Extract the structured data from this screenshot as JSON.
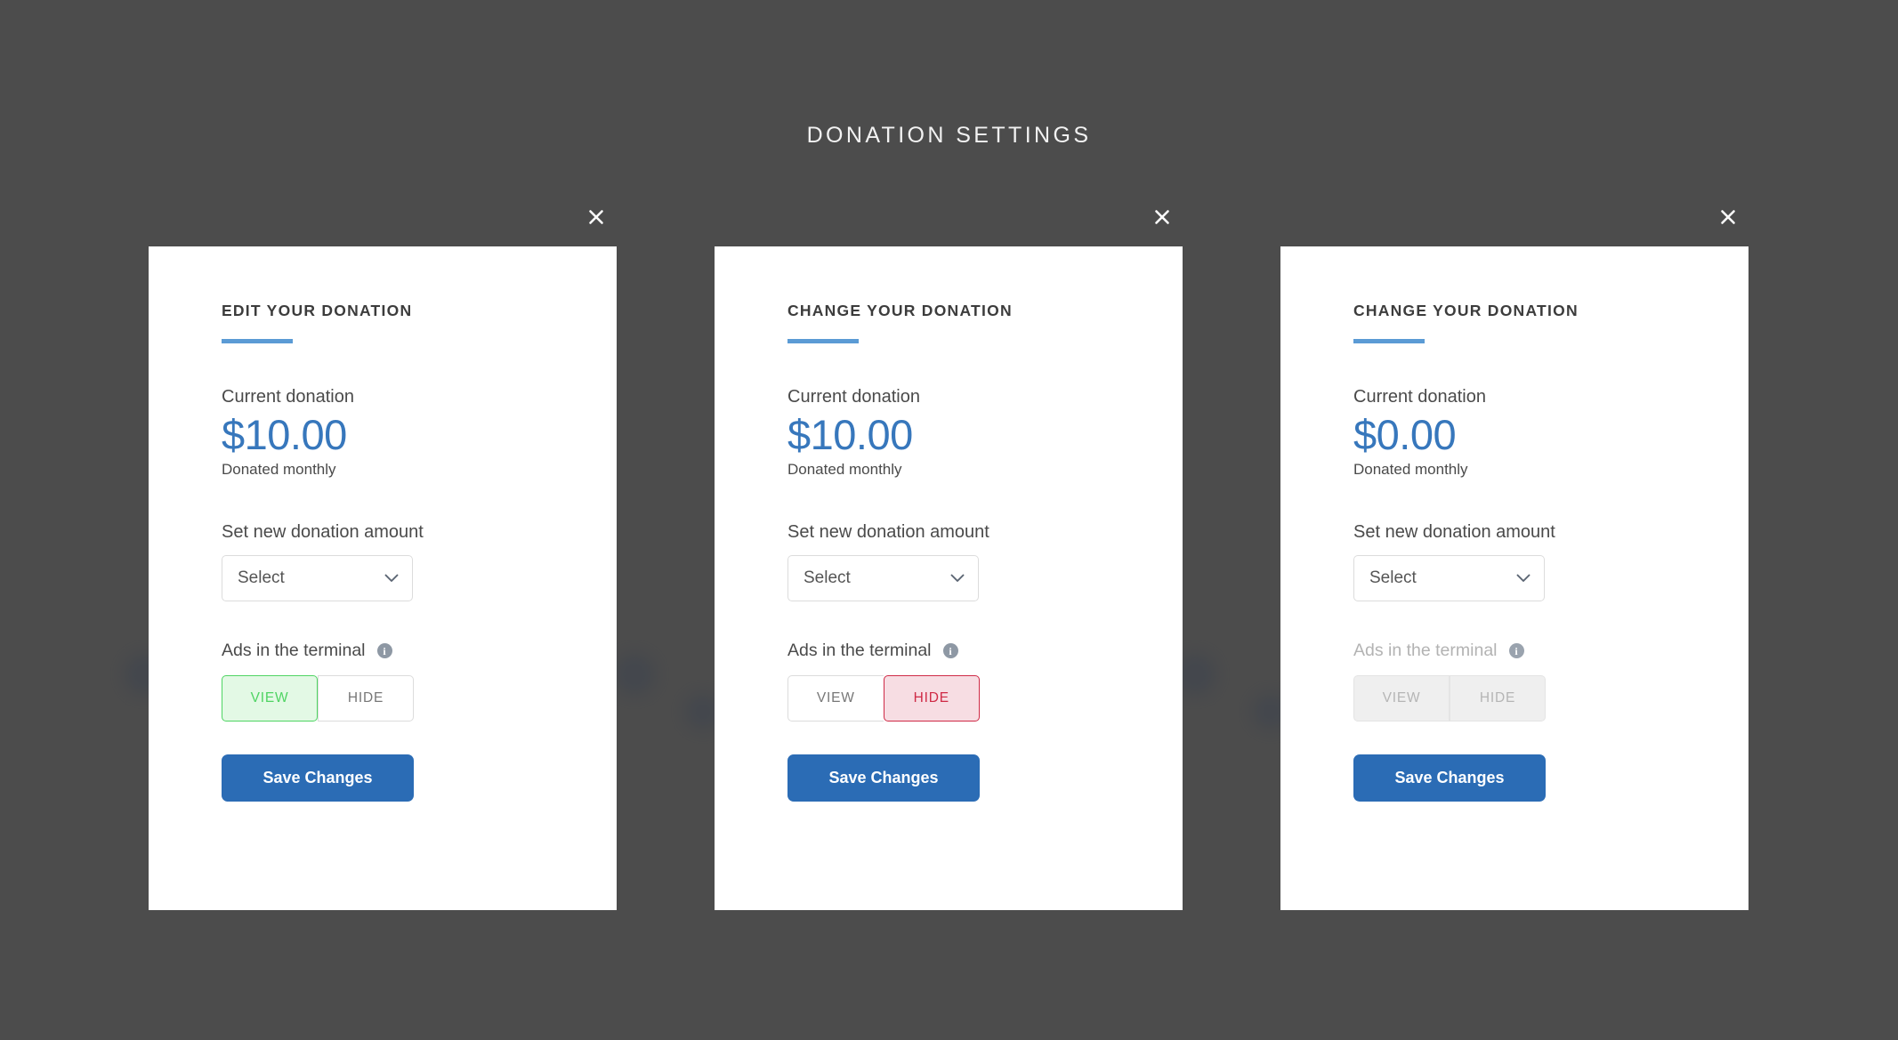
{
  "page": {
    "title": "DONATION SETTINGS",
    "background_color": "#4d4d4d",
    "accent_color": "#5b9bd5",
    "amount_color": "#3777bc",
    "save_button_color": "#2b6cb5",
    "view_active_color": "#4fd463",
    "hide_active_color": "#cf2a46"
  },
  "close_icon": "close-icon",
  "cards": [
    {
      "title": "EDIT YOUR DONATION",
      "current_label": "Current donation",
      "amount": "$10.00",
      "frequency": "Donated monthly",
      "set_amount_label": "Set new donation amount",
      "select": {
        "value": "Select",
        "placeholder": "Select",
        "chevron": "chevron-down-icon"
      },
      "ads_label": "Ads in the terminal",
      "info_icon": "info-icon",
      "info_glyph": "i",
      "toggle": {
        "view_label": "VIEW",
        "hide_label": "HIDE",
        "selected": "VIEW",
        "disabled": false
      },
      "save_label": "Save Changes"
    },
    {
      "title": "CHANGE YOUR DONATION",
      "current_label": "Current donation",
      "amount": "$10.00",
      "frequency": "Donated monthly",
      "set_amount_label": "Set new donation amount",
      "select": {
        "value": "Select",
        "placeholder": "Select",
        "chevron": "chevron-down-icon"
      },
      "ads_label": "Ads in the terminal",
      "info_icon": "info-icon",
      "info_glyph": "i",
      "toggle": {
        "view_label": "VIEW",
        "hide_label": "HIDE",
        "selected": "HIDE",
        "disabled": false
      },
      "save_label": "Save Changes"
    },
    {
      "title": "CHANGE YOUR DONATION",
      "current_label": "Current donation",
      "amount": "$0.00",
      "frequency": "Donated monthly",
      "set_amount_label": "Set new donation amount",
      "select": {
        "value": "Select",
        "placeholder": "Select",
        "chevron": "chevron-down-icon"
      },
      "ads_label": "Ads in the terminal",
      "info_icon": "info-icon",
      "info_glyph": "i",
      "toggle": {
        "view_label": "VIEW",
        "hide_label": "HIDE",
        "selected": "NONE",
        "disabled": true
      },
      "save_label": "Save Changes"
    }
  ]
}
